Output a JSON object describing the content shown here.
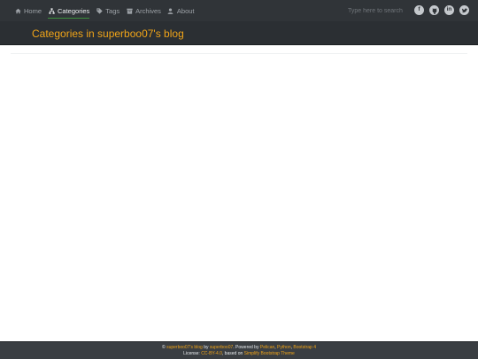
{
  "nav": {
    "items": [
      {
        "label": "Home",
        "icon": "home-icon",
        "active": false
      },
      {
        "label": "Categories",
        "icon": "sitemap-icon",
        "active": true
      },
      {
        "label": "Tags",
        "icon": "tag-icon",
        "active": false
      },
      {
        "label": "Archives",
        "icon": "archive-icon",
        "active": false
      },
      {
        "label": "About",
        "icon": "user-icon",
        "active": false
      }
    ],
    "search_placeholder": "Type here to search",
    "social": [
      "facebook-icon",
      "github-icon",
      "linkedin-icon",
      "twitter-icon"
    ]
  },
  "header": {
    "title": "Categories in superboo07's blog"
  },
  "footer": {
    "copyright_symbol": "©",
    "blog_link": "superboo07's blog",
    "by_text": "by",
    "author_link": "superboo07",
    "powered_text": ". Powered by",
    "pelican_link": "Pelican",
    "comma1": ",",
    "python_link": "Python",
    "comma2": ",",
    "bootstrap_link": "Bootstrap 4",
    "license_text": "License:",
    "license_link": "CC-BY-4.0",
    "based_text": ", based on",
    "theme_link": "Simplify Bootstrap Theme"
  },
  "colors": {
    "navbar_bg": "#303438",
    "header_bg": "#2b2f33",
    "accent": "#f0a418",
    "active_underline": "#3c8e3c",
    "footer_bg": "#3a3e42"
  }
}
